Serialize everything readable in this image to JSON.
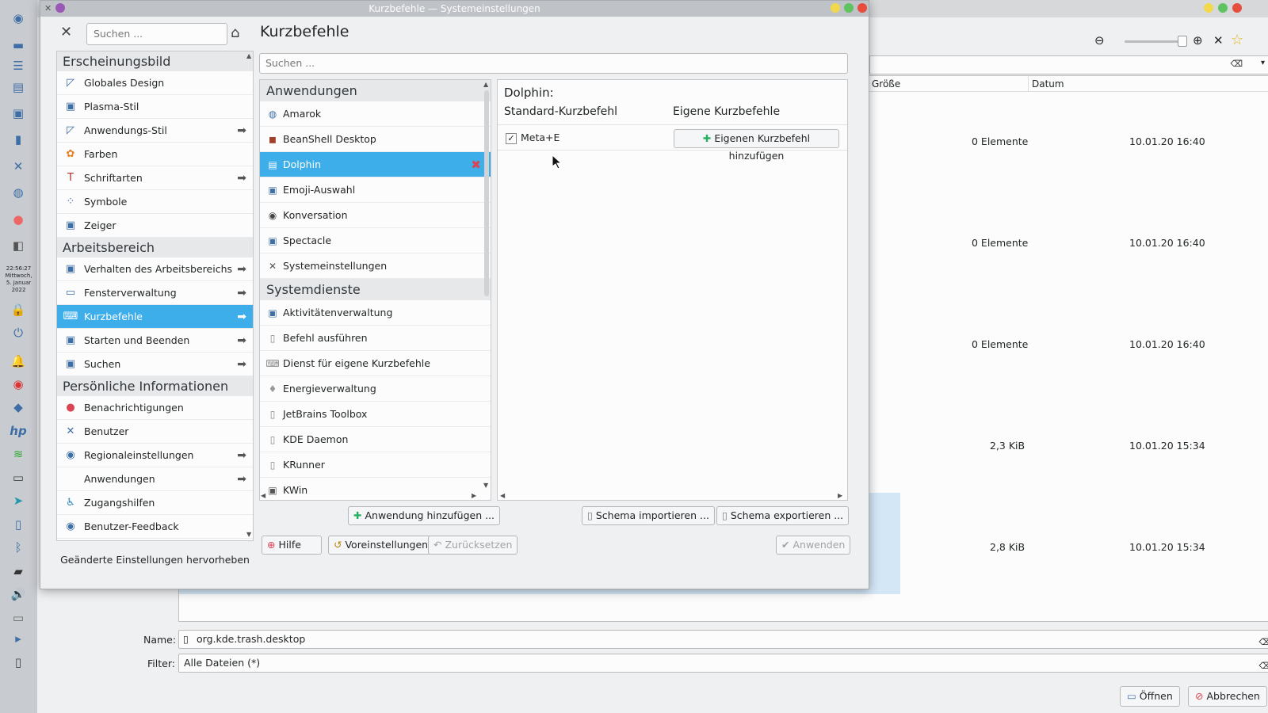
{
  "taskbar": {
    "clock_time": "22:56:27",
    "clock_day": "Mittwoch,",
    "clock_date": "5. Januar",
    "clock_year": "2022"
  },
  "background_dialog": {
    "columns": [
      "Größe",
      "Datum"
    ],
    "rows": [
      {
        "size": "0 Elemente",
        "date": "10.01.20 16:40"
      },
      {
        "size": "0 Elemente",
        "date": "10.01.20 16:40"
      },
      {
        "size": "0 Elemente",
        "date": "10.01.20 16:40"
      },
      {
        "size": "2,3 KiB",
        "date": "10.01.20 15:34"
      },
      {
        "size": "2,8 KiB",
        "date": "10.01.20 15:34"
      }
    ],
    "name_label": "Name:",
    "name_value": "org.kde.trash.desktop",
    "filter_label": "Filter:",
    "filter_value": "Alle Dateien (*)",
    "open_button": "Öffnen",
    "cancel_button": "Abbrechen"
  },
  "window": {
    "title": "Kurzbefehle — Systemeinstellungen"
  },
  "sidebar": {
    "search_placeholder": "Suchen ...",
    "categories": [
      {
        "label": "Erscheinungsbild",
        "items": [
          {
            "label": "Globales Design",
            "icon": "global-design-icon",
            "arrow": false
          },
          {
            "label": "Plasma-Stil",
            "icon": "plasma-style-icon",
            "arrow": false
          },
          {
            "label": "Anwendungs-Stil",
            "icon": "app-style-icon",
            "arrow": true
          },
          {
            "label": "Farben",
            "icon": "colors-icon",
            "arrow": false
          },
          {
            "label": "Schriftarten",
            "icon": "fonts-icon",
            "arrow": true
          },
          {
            "label": "Symbole",
            "icon": "icons-icon",
            "arrow": false
          },
          {
            "label": "Zeiger",
            "icon": "cursor-icon",
            "arrow": false
          }
        ]
      },
      {
        "label": "Arbeitsbereich",
        "items": [
          {
            "label": "Verhalten des Arbeitsbereichs",
            "icon": "workspace-icon",
            "arrow": true
          },
          {
            "label": "Fensterverwaltung",
            "icon": "window-icon",
            "arrow": true
          },
          {
            "label": "Kurzbefehle",
            "icon": "keyboard-icon",
            "arrow": true,
            "active": true
          },
          {
            "label": "Starten und Beenden",
            "icon": "startup-icon",
            "arrow": true
          },
          {
            "label": "Suchen",
            "icon": "search-icon",
            "arrow": true
          }
        ]
      },
      {
        "label": "Persönliche Informationen",
        "items": [
          {
            "label": "Benachrichtigungen",
            "icon": "notification-icon",
            "arrow": false
          },
          {
            "label": "Benutzer",
            "icon": "user-icon",
            "arrow": false
          },
          {
            "label": "Regionaleinstellungen",
            "icon": "region-icon",
            "arrow": true
          },
          {
            "label": "Anwendungen",
            "icon": "",
            "arrow": true
          },
          {
            "label": "Zugangshilfen",
            "icon": "accessibility-icon",
            "arrow": false
          },
          {
            "label": "Benutzer-Feedback",
            "icon": "feedback-icon",
            "arrow": false
          }
        ]
      }
    ],
    "highlight_button": "Geänderte Einstellungen hervorheben"
  },
  "main": {
    "title": "Kurzbefehle",
    "search_placeholder": "Suchen ...",
    "applist": [
      {
        "label": "Anwendungen",
        "items": [
          "Amarok",
          "BeanShell Desktop",
          "Dolphin",
          "Emoji-Auswahl",
          "Konversation",
          "Spectacle",
          "Systemeinstellungen"
        ]
      },
      {
        "label": "Systemdienste",
        "items": [
          "Aktivitätenverwaltung",
          "Befehl ausführen",
          "Dienst für eigene Kurzbefehle",
          "Energieverwaltung",
          "JetBrains Toolbox",
          "KDE Daemon",
          "KRunner",
          "KWin"
        ]
      }
    ],
    "selected_app": "Dolphin",
    "detail": {
      "app_title": "Dolphin:",
      "col_standard": "Standard-Kurzbefehl",
      "col_custom": "Eigene Kurzbefehle",
      "shortcut": "Meta+E",
      "shortcut_checked": true,
      "add_custom_button": "Eigenen Kurzbefehl hinzufügen"
    },
    "add_app_button": "Anwendung hinzufügen ...",
    "import_button": "Schema importieren ...",
    "export_button": "Schema exportieren ..."
  },
  "footer": {
    "help": "Hilfe",
    "defaults": "Voreinstellungen",
    "reset": "Zurücksetzen",
    "apply": "Anwenden"
  },
  "colors": {
    "accent": "#3daee9",
    "delete": "#da4453",
    "plus": "#27ae60"
  }
}
